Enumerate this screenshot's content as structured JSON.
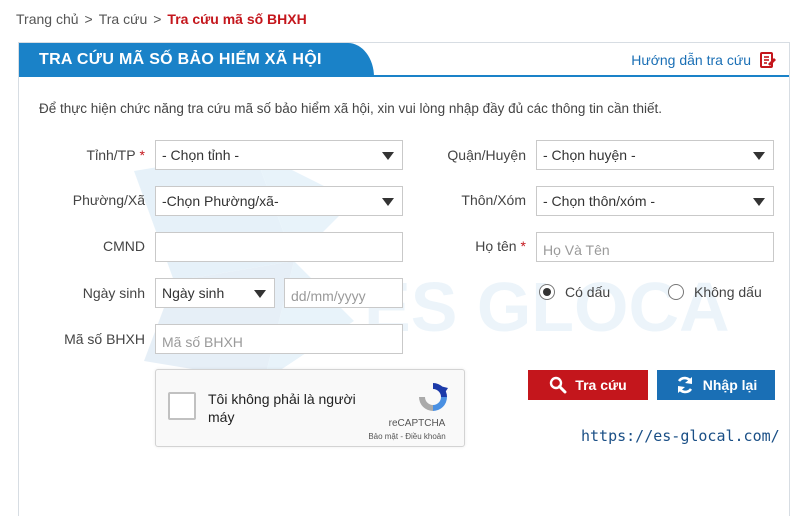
{
  "breadcrumb": {
    "home": "Trang chủ",
    "section": "Tra cứu",
    "current": "Tra cứu mã số BHXH",
    "separator": ">"
  },
  "panel": {
    "title": "TRA CỨU MÃ SỐ BẢO HIỂM XÃ HỘI",
    "guide_link": "Hướng dẫn tra cứu",
    "guide_icon": "edit-document-icon",
    "intro": "Để thực hiện chức năng tra cứu mã số bảo hiểm xã hội, xin vui lòng nhập đầy đủ các thông tin cần thiết."
  },
  "form": {
    "province": {
      "label": "Tỉnh/TP",
      "required_mark": "*",
      "value": "- Chọn tỉnh -"
    },
    "district": {
      "label": "Quận/Huyện",
      "value": "- Chọn huyện -"
    },
    "ward": {
      "label": "Phường/Xã",
      "value": "-Chọn Phường/xã-"
    },
    "village": {
      "label": "Thôn/Xóm",
      "value": "- Chọn thôn/xóm -"
    },
    "id_card": {
      "label": "CMND",
      "value": "",
      "placeholder": ""
    },
    "full_name": {
      "label": "Họ tên",
      "required_mark": "*",
      "value": "",
      "placeholder": "Họ Và Tên"
    },
    "birth_date": {
      "label": "Ngày sinh",
      "type_value": "Ngày sinh",
      "placeholder": "dd/mm/yyyy"
    },
    "accent": {
      "with_accent": "Có dấu",
      "without_accent": "Không dấu",
      "selected": "with_accent"
    },
    "bhxh_code": {
      "label": "Mã số BHXH",
      "placeholder": "Mã số BHXH"
    }
  },
  "captcha": {
    "text": "Tôi không phải là người máy",
    "brand": "reCAPTCHA",
    "terms": "Bảo mật - Điều khoản"
  },
  "buttons": {
    "search": "Tra cứu",
    "reset": "Nhập lại"
  },
  "watermark": {
    "text": "ES GLOCAL"
  },
  "footer_url": "https://es-glocal.com/",
  "colors": {
    "primary_blue": "#1a82c8",
    "button_blue": "#1a6fb5",
    "accent_red": "#c4161c"
  }
}
